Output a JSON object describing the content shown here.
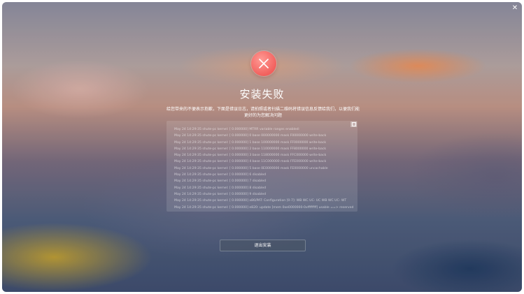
{
  "window": {
    "close_icon": "close-icon"
  },
  "status": {
    "icon": "close-circle-icon",
    "icon_color": "#f2605d",
    "title": "安装失败",
    "description": "给您带来的不便表示抱歉，下面是错误日志，请拍照或者扫描二维码将错误信息反馈给我们，以便我们能更好的为您解决问题"
  },
  "log": {
    "copy_icon": "copy-icon",
    "lines": [
      "May 24 14:29:35 shute-pc kernel: [    0.000000] MTRR variable ranges enabled:",
      "May 24 14:29:35 shute-pc kernel: [    0.000000]   0 base 000000000 mask F00000000 write-back",
      "May 24 14:29:35 shute-pc kernel: [    0.000000]   1 base 100000000 mask FF0000000 write-back",
      "May 24 14:29:35 shute-pc kernel: [    0.000000]   2 base 110000000 mask FF8000000 write-back",
      "May 24 14:29:35 shute-pc kernel: [    0.000000]   3 base 118000000 mask FFC000000 write-back",
      "May 24 14:29:35 shute-pc kernel: [    0.000000]   4 base 11C000000 mask FFE000000 write-back",
      "May 24 14:29:35 shute-pc kernel: [    0.000000]   5 base 0E0000000 mask FE0000000 uncachable",
      "May 24 14:29:35 shute-pc kernel: [    0.000000]   6 disabled",
      "May 24 14:29:35 shute-pc kernel: [    0.000000]   7 disabled",
      "May 24 14:29:35 shute-pc kernel: [    0.000000]   8 disabled",
      "May 24 14:29:35 shute-pc kernel: [    0.000000]   9 disabled",
      "May 24 14:29:35 shute-pc kernel: [    0.000000] x86/PAT: Configuration [0-7]: WB  WC  UC- UC  WB  WC  UC- WT",
      "May 24 14:29:35 shute-pc kernel: [    0.000000] e820: update [mem 0xe0000000-0xffffffff] usable ==> reserved"
    ]
  },
  "actions": {
    "exit_label": "退出安装"
  }
}
